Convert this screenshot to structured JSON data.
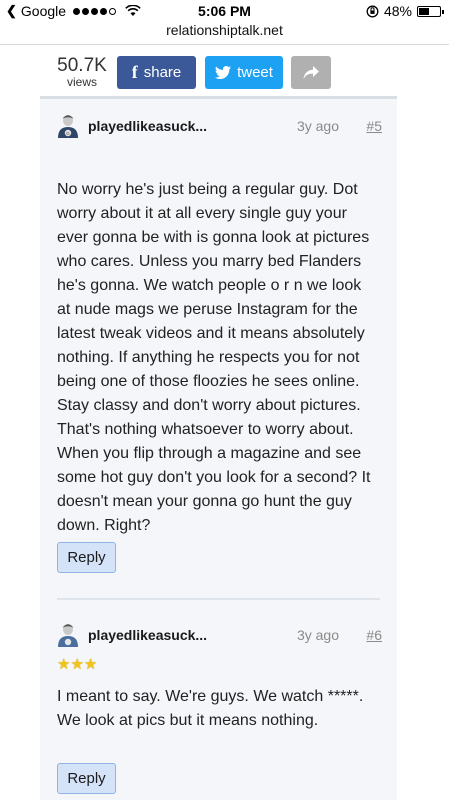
{
  "status_bar": {
    "carrier": "Google",
    "time": "5:06 PM",
    "battery": "48%",
    "battery_level": 0.48
  },
  "browser": {
    "url": "relationshiptalk.net"
  },
  "toolbar": {
    "views_count": "50.7K",
    "views_label": "views",
    "share_label": "share",
    "tweet_label": "tweet",
    "icons": {
      "facebook": "facebook-icon",
      "twitter": "twitter-bird-icon",
      "forward": "forward-arrow-icon"
    }
  },
  "posts": [
    {
      "username": "playedlikeasuck...",
      "time_ago": "3y ago",
      "number": "#5",
      "body": "No worry he's just being a regular guy. Dot\nworry about it at all every single guy your\never gonna be with is gonna look at pictures\nwho cares. Unless you marry bed Flanders\nhe's gonna. We watch people o r n we look\nat nude mags we peruse Instagram for the\nlatest tweak videos and it means absolutely\nnothing. If anything he respects you for not\nbeing one of those floozies he sees online.\nStay classy and don't worry about pictures.\nThat's nothing whatsoever to worry about.\nWhen you flip through a magazine and see\nsome hot guy don't you look for a second? It\ndoesn't mean your gonna go hunt the guy\ndown. Right?",
      "reply_label": "Reply"
    },
    {
      "username": "playedlikeasuck...",
      "time_ago": "3y ago",
      "number": "#6",
      "stars": "★★★",
      "star_rating": 3,
      "body": "I meant to say. We're guys. We watch *****.\nWe look at pics but it means nothing.",
      "reply_label": "Reply"
    }
  ]
}
